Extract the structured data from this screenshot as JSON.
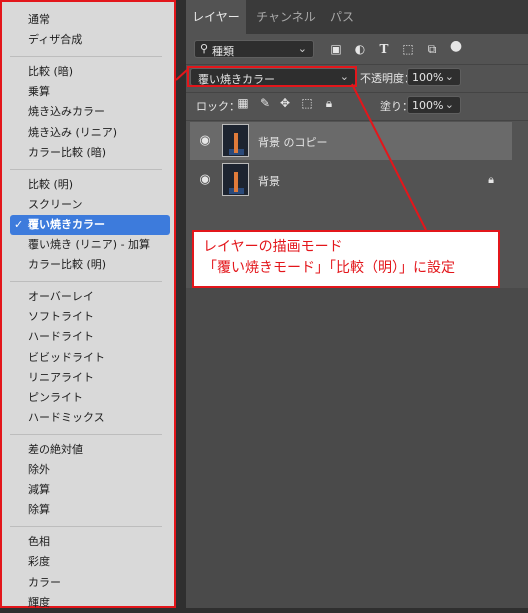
{
  "panel": {
    "tabs": [
      "レイヤー",
      "チャンネル",
      "パス"
    ],
    "filter": {
      "label": "種類"
    },
    "blend_mode": "覆い焼きカラー",
    "opacity_label": "不透明度：",
    "opacity_value": "100%",
    "lock_label": "ロック：",
    "fill_label": "塗り：",
    "fill_value": "100%",
    "layers": [
      {
        "name": "背景 のコピー",
        "selected": true,
        "locked": false
      },
      {
        "name": "背景",
        "selected": false,
        "locked": true
      }
    ]
  },
  "menu": {
    "groups": [
      [
        "通常",
        "ディザ合成"
      ],
      [
        "比較 (暗)",
        "乗算",
        "焼き込みカラー",
        "焼き込み (リニア)",
        "カラー比較 (暗)"
      ],
      [
        "比較 (明)",
        "スクリーン",
        "覆い焼きカラー",
        "覆い焼き (リニア) - 加算",
        "カラー比較 (明)"
      ],
      [
        "オーバーレイ",
        "ソフトライト",
        "ハードライト",
        "ビビッドライト",
        "リニアライト",
        "ピンライト",
        "ハードミックス"
      ],
      [
        "差の絶対値",
        "除外",
        "減算",
        "除算"
      ],
      [
        "色相",
        "彩度",
        "カラー",
        "輝度"
      ]
    ],
    "selected": "覆い焼きカラー",
    "check_mark": "✓"
  },
  "annotation": {
    "line1": "レイヤーの描画モード",
    "line2": "「覆い焼きモード」「比較（明）」に設定"
  },
  "colors": {
    "accent_red": "#e3161b",
    "menu_highlight": "#3d7bdc"
  }
}
